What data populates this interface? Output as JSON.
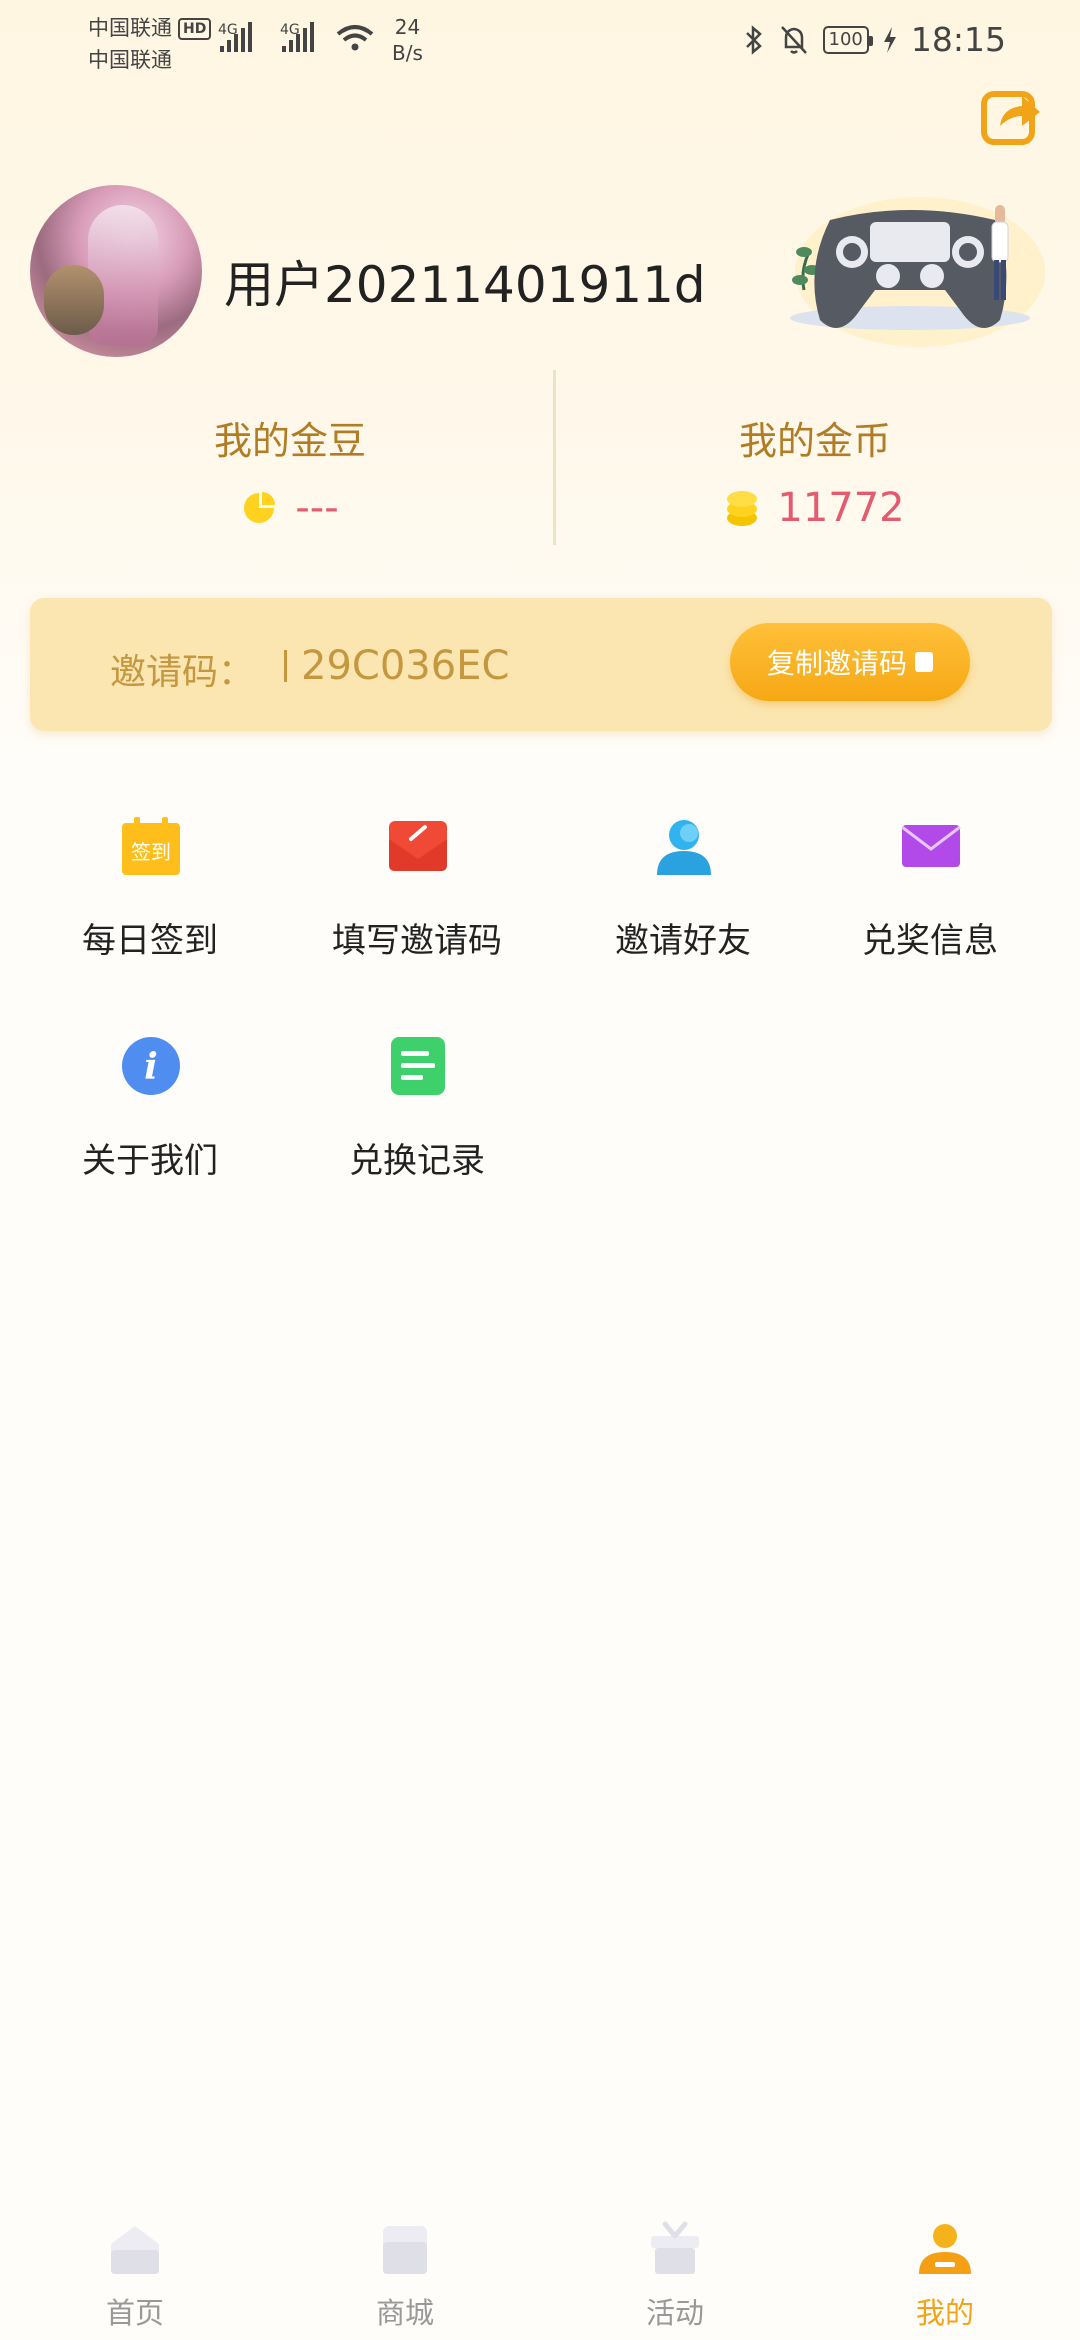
{
  "status_bar": {
    "carrier_1": "中国联通",
    "carrier_2": "中国联通",
    "hd": "HD",
    "signal_1": "4G",
    "signal_2": "4G",
    "speed_value": "24",
    "speed_unit": "B/s",
    "battery": "100",
    "time": "18:15"
  },
  "profile": {
    "username": "用户20211401911d"
  },
  "stats": {
    "beans_title": "我的金豆",
    "beans_value": "---",
    "coins_title": "我的金币",
    "coins_value": "11772"
  },
  "invite": {
    "label": "邀请码：",
    "code": "29C036EC",
    "copy_label": "复制邀请码"
  },
  "menu": {
    "items": [
      {
        "label": "每日签到",
        "icon": "daily-checkin-icon",
        "icon_text": "签到"
      },
      {
        "label": "填写邀请码",
        "icon": "envelope-red-icon"
      },
      {
        "label": "邀请好友",
        "icon": "user-icon"
      },
      {
        "label": "兑奖信息",
        "icon": "mail-icon"
      },
      {
        "label": "关于我们",
        "icon": "info-icon",
        "icon_text": "i"
      },
      {
        "label": "兑换记录",
        "icon": "document-icon"
      }
    ]
  },
  "bottom_nav": {
    "items": [
      {
        "label": "首页",
        "icon": "home-icon"
      },
      {
        "label": "商城",
        "icon": "shop-icon"
      },
      {
        "label": "活动",
        "icon": "gift-icon"
      },
      {
        "label": "我的",
        "icon": "profile-icon"
      }
    ],
    "active": "我的"
  },
  "colors": {
    "accent": "#f6a814",
    "gold_text": "#b07d24",
    "value_pink": "#e45a6e",
    "banner": "#fbe6b1"
  }
}
